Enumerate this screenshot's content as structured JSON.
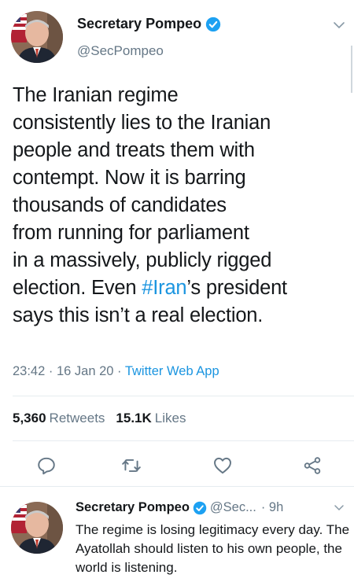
{
  "tweet": {
    "display_name": "Secretary Pompeo",
    "handle": "@SecPompeo",
    "text_before_hashtag": "The Iranian regime\nconsistently lies to the Iranian\npeople and treats them with\ncontempt. Now it is barring\nthousands of candidates\nfrom running for parliament\nin a massively, publicly rigged\nelection. Even ",
    "hashtag": "#Iran",
    "text_after_hashtag": "’s president\nsays this isn’t a real election.",
    "time": "23:42",
    "date": "16 Jan 20",
    "source": "Twitter Web App",
    "meta_separator": " · ",
    "retweets_count": "5,360",
    "retweets_label": "Retweets",
    "likes_count": "15.1K",
    "likes_label": "Likes"
  },
  "reply": {
    "display_name": "Secretary Pompeo",
    "handle": "@Sec...",
    "time": "· 9h",
    "text": "The regime is losing legitimacy every day. The Ayatollah should listen to his own people, the world is listening."
  },
  "icons": {
    "verified": "verified-badge-icon",
    "chevron": "chevron-down-icon",
    "reply": "reply-icon",
    "retweet": "retweet-icon",
    "like": "heart-icon",
    "share": "share-icon"
  },
  "colors": {
    "accent": "#1b95e0",
    "text": "#14171a",
    "secondary": "#657786",
    "divider": "#e6ecf0"
  }
}
